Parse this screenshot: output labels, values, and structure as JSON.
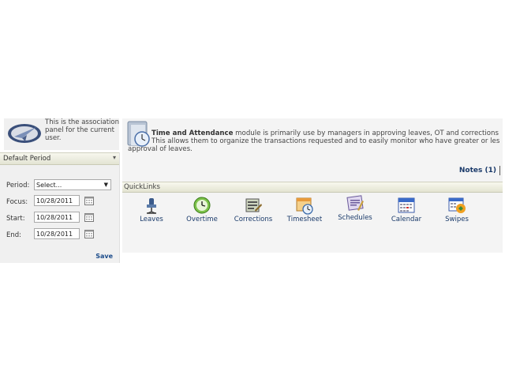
{
  "association": {
    "text": "This is the association panel for the current user."
  },
  "period": {
    "title": "Default Period",
    "period_label": "Period:",
    "period_value": "Select...",
    "focus_label": "Focus:",
    "focus_value": "10/28/2011",
    "start_label": "Start:",
    "start_value": "10/28/2011",
    "end_label": "End:",
    "end_value": "10/28/2011",
    "save_label": "Save"
  },
  "intro": {
    "module_name": "Time and Attendance",
    "line1": " module is primarily use by managers in approving leaves, OT and corrections",
    "line2": "This allows them to organize the transactions requested and to easily monitor who have greater or les",
    "line3": "approval of leaves.",
    "notes_label": "Notes (1)"
  },
  "quicklinks": {
    "title": "QuickLinks",
    "items": [
      {
        "label": "Leaves",
        "icon": "leaves-icon"
      },
      {
        "label": "Overtime",
        "icon": "overtime-icon"
      },
      {
        "label": "Corrections",
        "icon": "corrections-icon"
      },
      {
        "label": "Timesheet",
        "icon": "timesheet-icon"
      },
      {
        "label": "Schedules",
        "icon": "schedules-icon"
      },
      {
        "label": "Calendar",
        "icon": "calendar-icon"
      },
      {
        "label": "Swipes",
        "icon": "swipes-icon"
      }
    ]
  }
}
